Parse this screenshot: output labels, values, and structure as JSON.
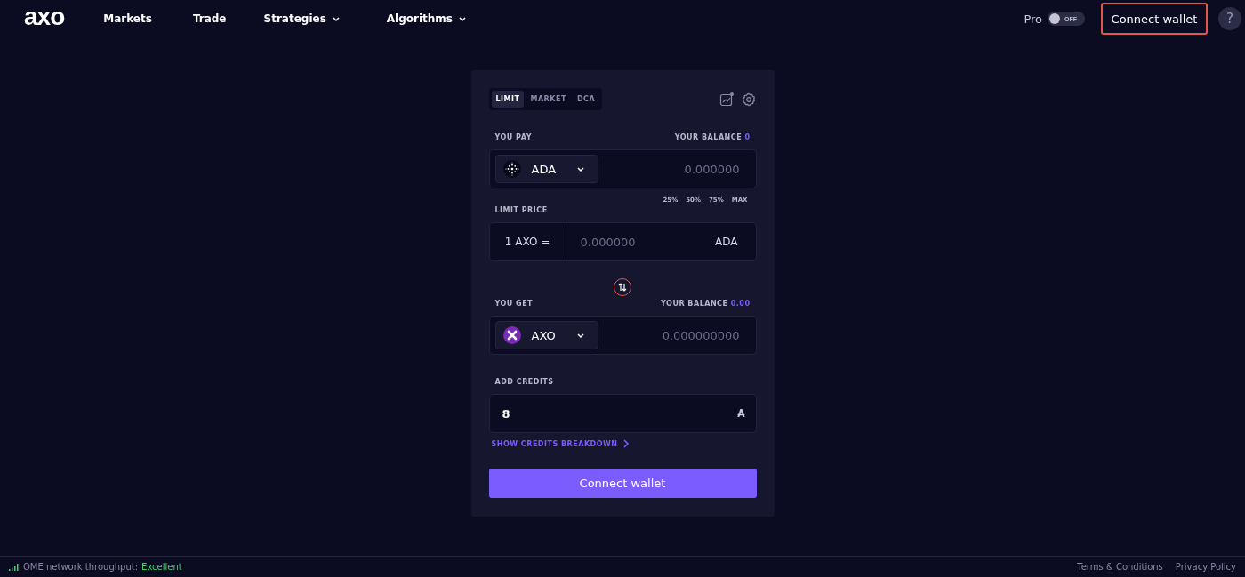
{
  "nav": {
    "logo": "axo",
    "links": [
      {
        "label": "Markets",
        "has_menu": false
      },
      {
        "label": "Trade",
        "has_menu": false
      },
      {
        "label": "Strategies",
        "has_menu": true
      },
      {
        "label": "Algorithms",
        "has_menu": true
      }
    ]
  },
  "pro_toggle": {
    "label": "Pro",
    "on": false,
    "state_text": "OFF"
  },
  "header_button": "Connect wallet",
  "help": "?",
  "order_tabs": [
    {
      "label": "LIMIT",
      "selected": true
    },
    {
      "label": "MARKET",
      "selected": false
    },
    {
      "label": "DCA",
      "selected": false
    }
  ],
  "pay": {
    "label": "YOU PAY",
    "balance_label": "YOUR BALANCE",
    "balance": "0",
    "token": "ADA",
    "kind": "ada",
    "placeholder": "0.000000"
  },
  "percent_buttons": [
    "25%",
    "50%",
    "75%",
    "MAX"
  ],
  "limit_price": {
    "label": "LIMIT PRICE",
    "prefix": "1 AXO =",
    "placeholder": "0.000000",
    "unit": "ADA"
  },
  "get": {
    "label": "YOU GET",
    "balance_label": "YOUR BALANCE",
    "balance": "0.00",
    "token": "AXO",
    "kind": "axo",
    "placeholder": "0.000000000"
  },
  "credits": {
    "label": "ADD CREDITS",
    "value": "8",
    "unit": "₳",
    "link": "SHOW CREDITS BREAKDOWN"
  },
  "submit": "Connect wallet",
  "footer": {
    "status_label": "OME network throughput:",
    "status_value": "Excellent",
    "links": [
      "Terms & Conditions",
      "Privacy Policy"
    ]
  }
}
